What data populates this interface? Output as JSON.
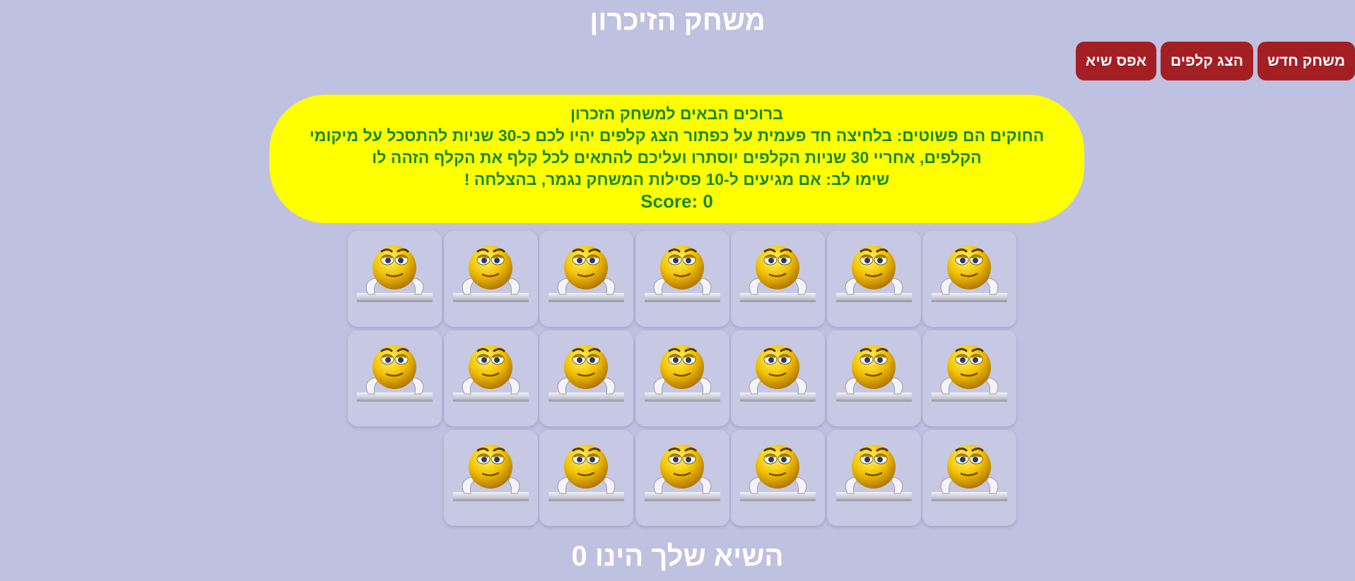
{
  "title": "משחק הזיכרון",
  "toolbar": {
    "new_game_label": "משחק חדש",
    "show_cards_label": "הצג קלפים",
    "reset_record_label": "אפס שיא"
  },
  "info": {
    "lines": [
      "ברוכים הבאים למשחק הזכרון",
      "החוקים הם פשוטים: בלחיצה חד פעמית על כפתור הצג קלפים יהיו לכם כ-30 שניות להתסכל על מיקומי",
      "הקלפים, אחריי 30 שניות הקלפים יוסתרו ועליכם להתאים לכל קלף את הקלף הזהה לו",
      "שימו לב: אם מגיעים ל-10 פסילות המשחק נגמר, בהצלחה !"
    ],
    "score_text": "Score: 0"
  },
  "board": {
    "rows": [
      7,
      7,
      6
    ],
    "card_back_icon": "smiley-card-back-icon"
  },
  "footer": {
    "record_text": "השיא שלך הינו 0"
  },
  "colors": {
    "background": "#bfc1e0",
    "button": "#a31f24",
    "info_box": "#ffff00",
    "info_text": "#1a8a1a",
    "card": "#c6c8e4"
  }
}
